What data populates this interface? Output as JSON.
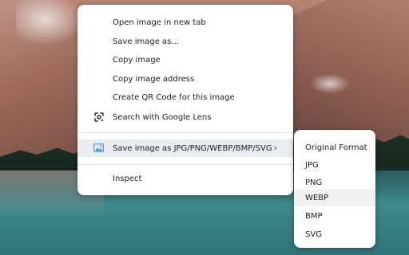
{
  "context_menu": {
    "items": [
      {
        "label": "Open image in new tab"
      },
      {
        "label": "Save image as..."
      },
      {
        "label": "Copy image"
      },
      {
        "label": "Copy image address"
      },
      {
        "label": "Create QR Code for this image"
      },
      {
        "label": "Search with Google Lens",
        "icon": "google-lens-icon"
      },
      {
        "label": "Save image as JPG/PNG/WEBP/BMP/SVG",
        "icon": "image-icon",
        "submenu_indicator": "›"
      },
      {
        "label": "Inspect"
      }
    ]
  },
  "submenu": {
    "items": [
      {
        "label": "Original Format"
      },
      {
        "label": "JPG"
      },
      {
        "label": "PNG"
      },
      {
        "label": "WEBP",
        "highlighted": true
      },
      {
        "label": "BMP"
      },
      {
        "label": "SVG"
      }
    ]
  },
  "colors": {
    "menu_background": "#ffffff",
    "selected_row": "#e9ecf0",
    "hover_row": "#f1f1f1",
    "text": "#202124",
    "icon_accent": "#4a90d9"
  }
}
